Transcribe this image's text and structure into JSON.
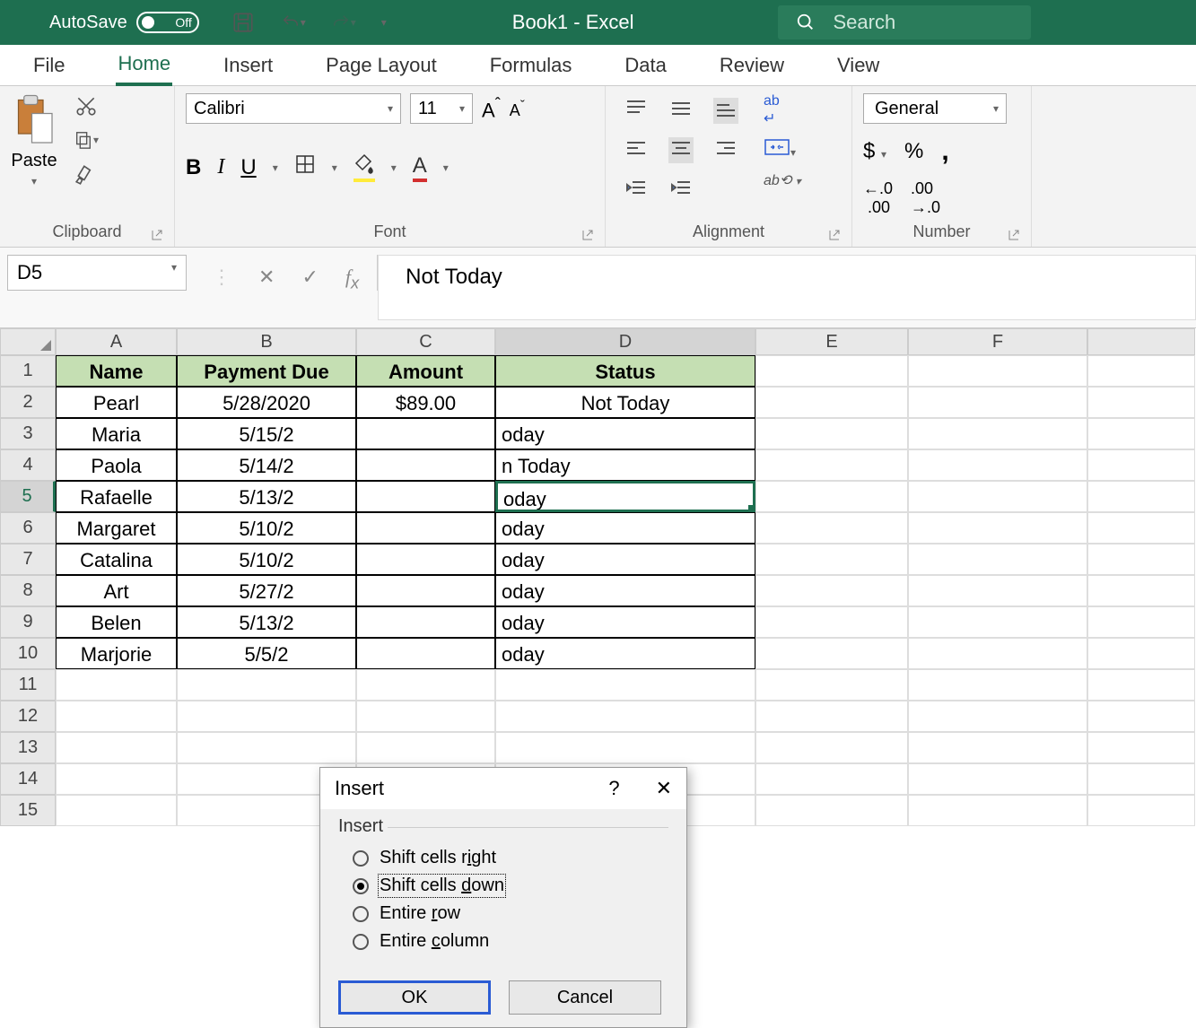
{
  "titlebar": {
    "autosave_label": "AutoSave",
    "autosave_state": "Off",
    "doc_title": "Book1 - Excel",
    "search_placeholder": "Search"
  },
  "tabs": [
    "File",
    "Home",
    "Insert",
    "Page Layout",
    "Formulas",
    "Data",
    "Review",
    "View"
  ],
  "active_tab": "Home",
  "ribbon": {
    "clipboard_label": "Clipboard",
    "paste_label": "Paste",
    "font_label": "Font",
    "font_name": "Calibri",
    "font_size": "11",
    "alignment_label": "Alignment",
    "number_label": "Number",
    "number_format": "General"
  },
  "namebox": "D5",
  "formula_value": "Not Today",
  "columns": [
    "A",
    "B",
    "C",
    "D",
    "E",
    "F"
  ],
  "table": {
    "headers": [
      "Name",
      "Payment Due",
      "Amount",
      "Status"
    ],
    "rows": [
      [
        "Pearl",
        "5/28/2020",
        "$89.00",
        "Not Today"
      ],
      [
        "Maria",
        "5/15/2",
        "",
        "oday"
      ],
      [
        "Paola",
        "5/14/2",
        "",
        "n Today"
      ],
      [
        "Rafaelle",
        "5/13/2",
        "",
        "oday"
      ],
      [
        "Margaret",
        "5/10/2",
        "",
        "oday"
      ],
      [
        "Catalina",
        "5/10/2",
        "",
        "oday"
      ],
      [
        "Art",
        "5/27/2",
        "",
        "oday"
      ],
      [
        "Belen",
        "5/13/2",
        "",
        "oday"
      ],
      [
        "Marjorie",
        "5/5/2",
        "",
        "oday"
      ]
    ]
  },
  "dialog": {
    "title": "Insert",
    "group_label": "Insert",
    "options": {
      "shift_right": "Shift cells right",
      "shift_down": "Shift cells down",
      "entire_row": "Entire row",
      "entire_col": "Entire column"
    },
    "selected": "shift_down",
    "ok": "OK",
    "cancel": "Cancel"
  }
}
